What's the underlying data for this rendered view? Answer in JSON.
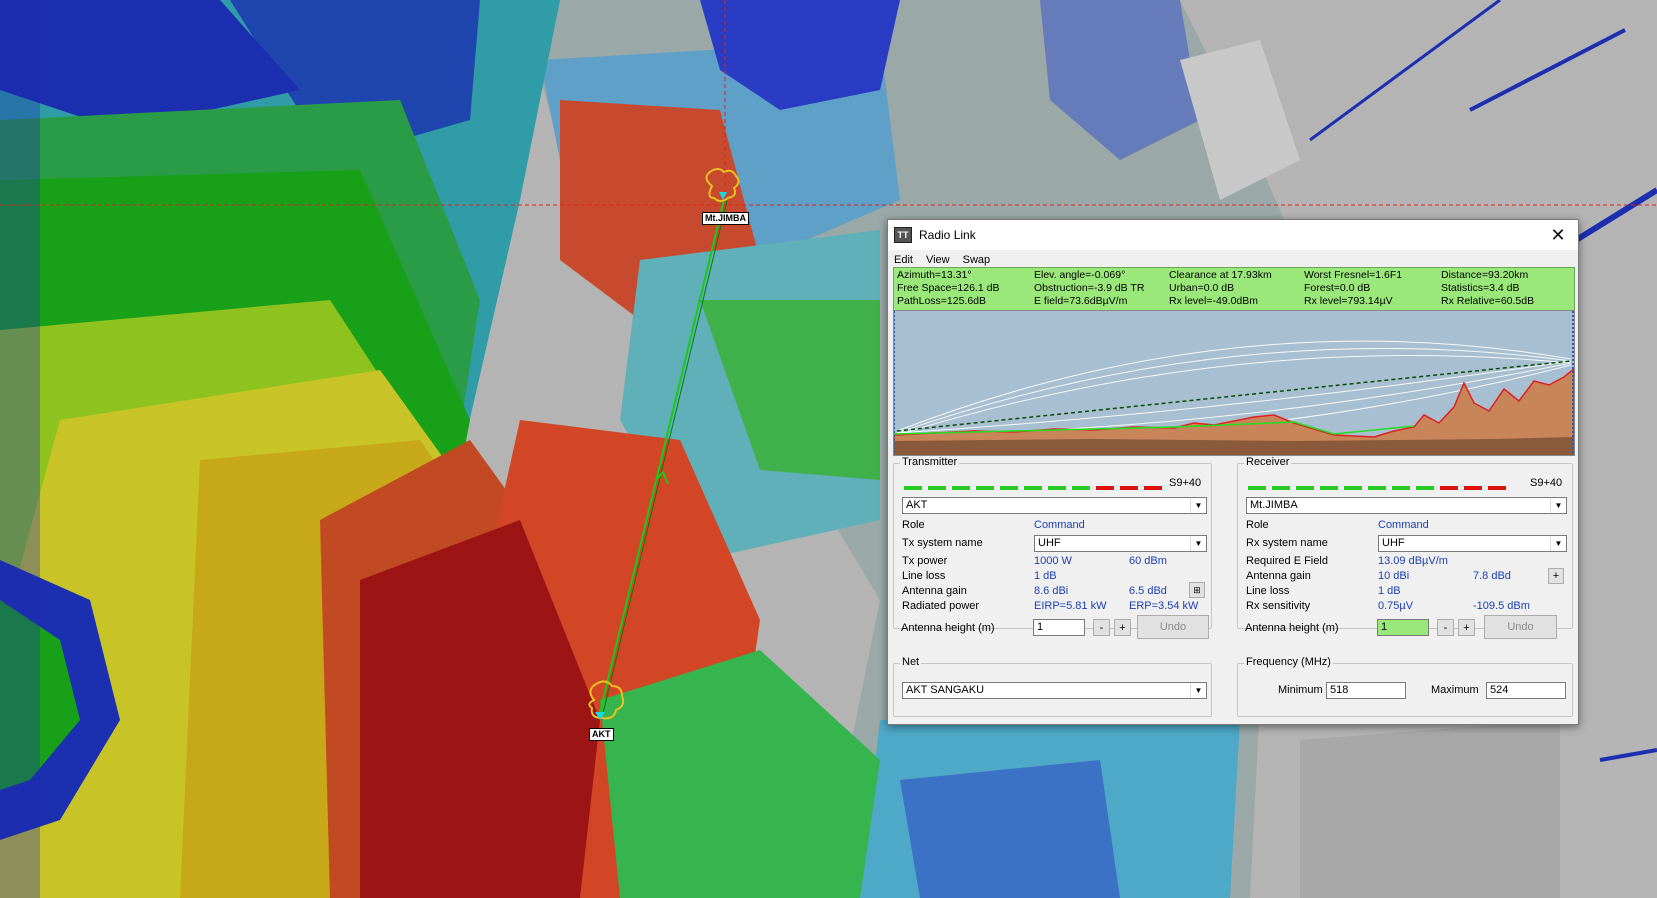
{
  "map": {
    "sites": [
      {
        "name": "Mt.JIMBA"
      },
      {
        "name": "AKT"
      }
    ]
  },
  "dialog": {
    "title": "Radio Link",
    "app_icon": "TT",
    "close_glyph": "✕",
    "menu": [
      "Edit",
      "View",
      "Swap"
    ],
    "stats": [
      [
        "Azimuth=13.31°",
        "Elev. angle=-0.069°",
        "Clearance at 17.93km",
        "Worst Fresnel=1.6F1",
        "Distance=93.20km"
      ],
      [
        "Free Space=126.1 dB",
        "Obstruction=-3.9 dB TR",
        "Urban=0.0 dB",
        "Forest=0.0 dB",
        "Statistics=3.4 dB"
      ],
      [
        "PathLoss=125.6dB",
        "E field=73.6dBµV/m",
        "Rx level=-49.0dBm",
        "Rx level=793.14µV",
        "Rx Relative=60.5dB"
      ]
    ],
    "transmitter": {
      "title": "Transmitter",
      "s_meter": "S9+40",
      "site": "AKT",
      "role_label": "Role",
      "role_value": "Command",
      "system_label": "Tx system name",
      "system_value": "UHF",
      "power_label": "Tx power",
      "power_w": "1000 W",
      "power_dbm": "60 dBm",
      "line_loss_label": "Line loss",
      "line_loss_value": "1 dB",
      "antenna_gain_label": "Antenna gain",
      "gain_dbi": "8.6 dBi",
      "gain_dbd": "6.5 dBd",
      "radiated_label": "Radiated power",
      "eirp": "EIRP=5.81 kW",
      "erp": "ERP=3.54 kW",
      "height_label": "Antenna height (m)",
      "height_value": "1",
      "minus": "-",
      "plus": "+",
      "undo": "Undo"
    },
    "receiver": {
      "title": "Receiver",
      "s_meter": "S9+40",
      "site": "Mt.JIMBA",
      "role_label": "Role",
      "role_value": "Command",
      "system_label": "Rx system name",
      "system_value": "UHF",
      "efield_label": "Required E Field",
      "efield_value": "13.09 dBµV/m",
      "antenna_gain_label": "Antenna gain",
      "gain_dbi": "10 dBi",
      "gain_dbd": "7.8 dBd",
      "line_loss_label": "Line loss",
      "line_loss_value": "1 dB",
      "sens_label": "Rx sensitivity",
      "sens_uv": "0.75µV",
      "sens_dbm": "-109.5 dBm",
      "height_label": "Antenna height (m)",
      "height_value": "1",
      "minus": "-",
      "plus": "+",
      "undo": "Undo"
    },
    "net": {
      "title": "Net",
      "value": "AKT SANGAKU"
    },
    "frequency": {
      "title": "Frequency (MHz)",
      "min_label": "Minimum",
      "min_value": "518",
      "max_label": "Maximum",
      "max_value": "524"
    },
    "colors": {
      "stats_bg": "#9be87a",
      "meter_green": "#22cc22",
      "meter_red": "#dd1111",
      "value_blue": "#1b3fb3"
    }
  }
}
